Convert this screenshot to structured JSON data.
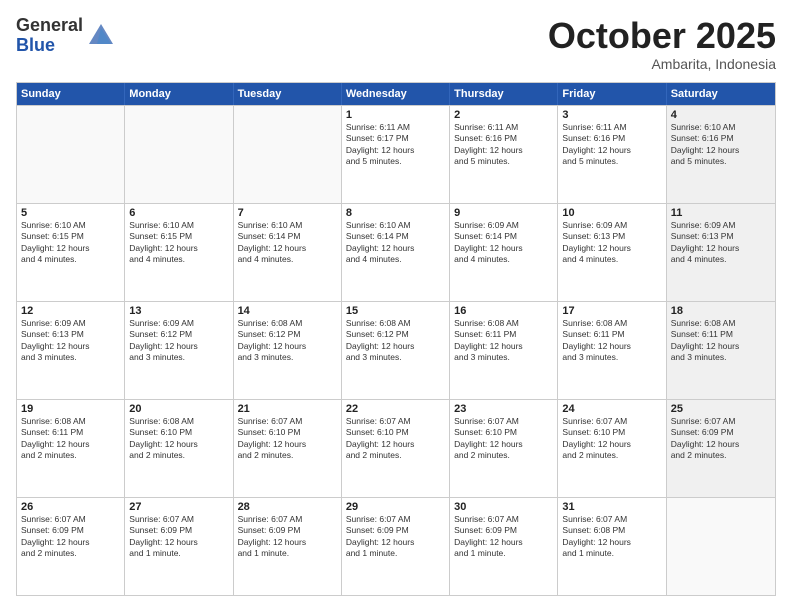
{
  "logo": {
    "general": "General",
    "blue": "Blue"
  },
  "title": "October 2025",
  "subtitle": "Ambarita, Indonesia",
  "days": [
    "Sunday",
    "Monday",
    "Tuesday",
    "Wednesday",
    "Thursday",
    "Friday",
    "Saturday"
  ],
  "weeks": [
    [
      {
        "day": "",
        "detail": "",
        "empty": true
      },
      {
        "day": "",
        "detail": "",
        "empty": true
      },
      {
        "day": "",
        "detail": "",
        "empty": true
      },
      {
        "day": "1",
        "detail": "Sunrise: 6:11 AM\nSunset: 6:17 PM\nDaylight: 12 hours\nand 5 minutes."
      },
      {
        "day": "2",
        "detail": "Sunrise: 6:11 AM\nSunset: 6:16 PM\nDaylight: 12 hours\nand 5 minutes."
      },
      {
        "day": "3",
        "detail": "Sunrise: 6:11 AM\nSunset: 6:16 PM\nDaylight: 12 hours\nand 5 minutes."
      },
      {
        "day": "4",
        "detail": "Sunrise: 6:10 AM\nSunset: 6:16 PM\nDaylight: 12 hours\nand 5 minutes.",
        "shaded": true
      }
    ],
    [
      {
        "day": "5",
        "detail": "Sunrise: 6:10 AM\nSunset: 6:15 PM\nDaylight: 12 hours\nand 4 minutes."
      },
      {
        "day": "6",
        "detail": "Sunrise: 6:10 AM\nSunset: 6:15 PM\nDaylight: 12 hours\nand 4 minutes."
      },
      {
        "day": "7",
        "detail": "Sunrise: 6:10 AM\nSunset: 6:14 PM\nDaylight: 12 hours\nand 4 minutes."
      },
      {
        "day": "8",
        "detail": "Sunrise: 6:10 AM\nSunset: 6:14 PM\nDaylight: 12 hours\nand 4 minutes."
      },
      {
        "day": "9",
        "detail": "Sunrise: 6:09 AM\nSunset: 6:14 PM\nDaylight: 12 hours\nand 4 minutes."
      },
      {
        "day": "10",
        "detail": "Sunrise: 6:09 AM\nSunset: 6:13 PM\nDaylight: 12 hours\nand 4 minutes."
      },
      {
        "day": "11",
        "detail": "Sunrise: 6:09 AM\nSunset: 6:13 PM\nDaylight: 12 hours\nand 4 minutes.",
        "shaded": true
      }
    ],
    [
      {
        "day": "12",
        "detail": "Sunrise: 6:09 AM\nSunset: 6:13 PM\nDaylight: 12 hours\nand 3 minutes."
      },
      {
        "day": "13",
        "detail": "Sunrise: 6:09 AM\nSunset: 6:12 PM\nDaylight: 12 hours\nand 3 minutes."
      },
      {
        "day": "14",
        "detail": "Sunrise: 6:08 AM\nSunset: 6:12 PM\nDaylight: 12 hours\nand 3 minutes."
      },
      {
        "day": "15",
        "detail": "Sunrise: 6:08 AM\nSunset: 6:12 PM\nDaylight: 12 hours\nand 3 minutes."
      },
      {
        "day": "16",
        "detail": "Sunrise: 6:08 AM\nSunset: 6:11 PM\nDaylight: 12 hours\nand 3 minutes."
      },
      {
        "day": "17",
        "detail": "Sunrise: 6:08 AM\nSunset: 6:11 PM\nDaylight: 12 hours\nand 3 minutes."
      },
      {
        "day": "18",
        "detail": "Sunrise: 6:08 AM\nSunset: 6:11 PM\nDaylight: 12 hours\nand 3 minutes.",
        "shaded": true
      }
    ],
    [
      {
        "day": "19",
        "detail": "Sunrise: 6:08 AM\nSunset: 6:11 PM\nDaylight: 12 hours\nand 2 minutes."
      },
      {
        "day": "20",
        "detail": "Sunrise: 6:08 AM\nSunset: 6:10 PM\nDaylight: 12 hours\nand 2 minutes."
      },
      {
        "day": "21",
        "detail": "Sunrise: 6:07 AM\nSunset: 6:10 PM\nDaylight: 12 hours\nand 2 minutes."
      },
      {
        "day": "22",
        "detail": "Sunrise: 6:07 AM\nSunset: 6:10 PM\nDaylight: 12 hours\nand 2 minutes."
      },
      {
        "day": "23",
        "detail": "Sunrise: 6:07 AM\nSunset: 6:10 PM\nDaylight: 12 hours\nand 2 minutes."
      },
      {
        "day": "24",
        "detail": "Sunrise: 6:07 AM\nSunset: 6:10 PM\nDaylight: 12 hours\nand 2 minutes."
      },
      {
        "day": "25",
        "detail": "Sunrise: 6:07 AM\nSunset: 6:09 PM\nDaylight: 12 hours\nand 2 minutes.",
        "shaded": true
      }
    ],
    [
      {
        "day": "26",
        "detail": "Sunrise: 6:07 AM\nSunset: 6:09 PM\nDaylight: 12 hours\nand 2 minutes."
      },
      {
        "day": "27",
        "detail": "Sunrise: 6:07 AM\nSunset: 6:09 PM\nDaylight: 12 hours\nand 1 minute."
      },
      {
        "day": "28",
        "detail": "Sunrise: 6:07 AM\nSunset: 6:09 PM\nDaylight: 12 hours\nand 1 minute."
      },
      {
        "day": "29",
        "detail": "Sunrise: 6:07 AM\nSunset: 6:09 PM\nDaylight: 12 hours\nand 1 minute."
      },
      {
        "day": "30",
        "detail": "Sunrise: 6:07 AM\nSunset: 6:09 PM\nDaylight: 12 hours\nand 1 minute."
      },
      {
        "day": "31",
        "detail": "Sunrise: 6:07 AM\nSunset: 6:08 PM\nDaylight: 12 hours\nand 1 minute."
      },
      {
        "day": "",
        "detail": "",
        "empty": true,
        "shaded": true
      }
    ]
  ]
}
